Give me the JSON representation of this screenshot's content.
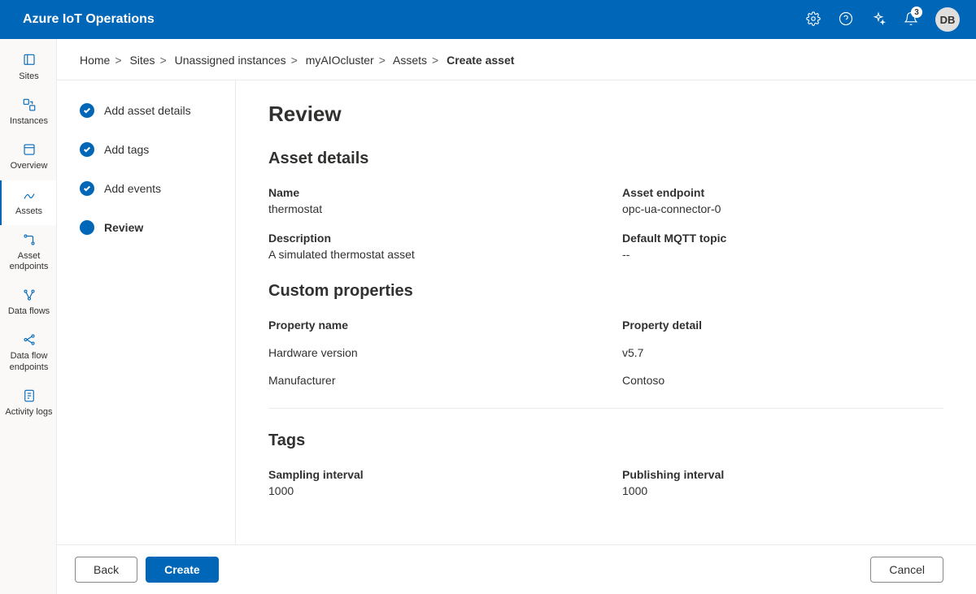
{
  "brand": "Azure IoT Operations",
  "notifications_count": "3",
  "avatar_initials": "DB",
  "rail": [
    {
      "key": "sites",
      "label": "Sites"
    },
    {
      "key": "instances",
      "label": "Instances"
    },
    {
      "key": "overview",
      "label": "Overview"
    },
    {
      "key": "assets",
      "label": "Assets"
    },
    {
      "key": "asset-endpoints",
      "label": "Asset endpoints"
    },
    {
      "key": "data-flows",
      "label": "Data flows"
    },
    {
      "key": "data-flow-endpoints",
      "label": "Data flow endpoints"
    },
    {
      "key": "activity-logs",
      "label": "Activity logs"
    }
  ],
  "breadcrumbs": {
    "items": [
      "Home",
      "Sites",
      "Unassigned instances",
      "myAIOcluster",
      "Assets"
    ],
    "current": "Create asset"
  },
  "wizard": {
    "steps": [
      {
        "label": "Add asset details",
        "done": true
      },
      {
        "label": "Add tags",
        "done": true
      },
      {
        "label": "Add events",
        "done": true
      },
      {
        "label": "Review",
        "current": true
      }
    ]
  },
  "page": {
    "title": "Review",
    "asset_details": {
      "heading": "Asset details",
      "name_label": "Name",
      "name_value": "thermostat",
      "endpoint_label": "Asset endpoint",
      "endpoint_value": "opc-ua-connector-0",
      "description_label": "Description",
      "description_value": "A simulated thermostat asset",
      "mqtt_label": "Default MQTT topic",
      "mqtt_value": "--"
    },
    "custom_properties": {
      "heading": "Custom properties",
      "col_name": "Property name",
      "col_detail": "Property detail",
      "rows": [
        {
          "name": "Hardware version",
          "detail": "v5.7"
        },
        {
          "name": "Manufacturer",
          "detail": "Contoso"
        }
      ]
    },
    "tags": {
      "heading": "Tags",
      "sampling_label": "Sampling interval",
      "sampling_value": "1000",
      "publishing_label": "Publishing interval",
      "publishing_value": "1000"
    }
  },
  "buttons": {
    "back": "Back",
    "create": "Create",
    "cancel": "Cancel"
  }
}
